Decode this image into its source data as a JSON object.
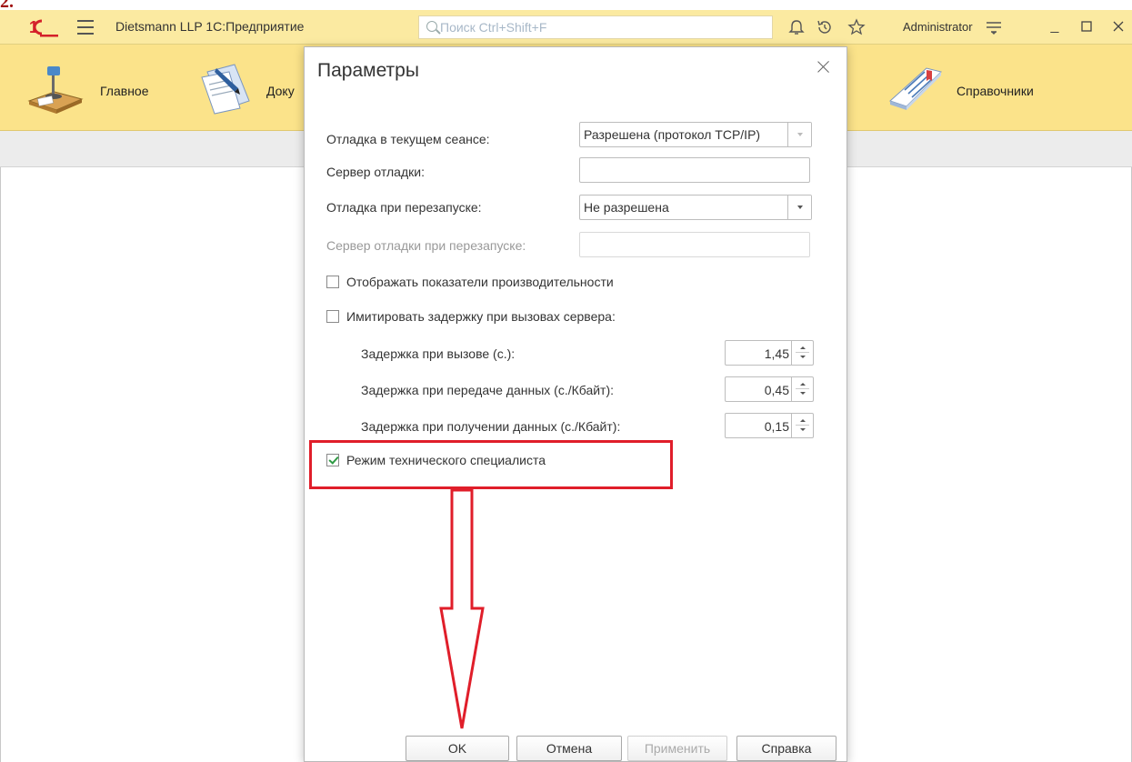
{
  "step_label": "2.",
  "titlebar": {
    "app_title": "Dietsmann LLP  1С:Предприятие",
    "search_placeholder": "Поиск Ctrl+Shift+F",
    "user": "Administrator"
  },
  "sections": [
    {
      "label": "Главное",
      "icon": "desk-lamp-icon"
    },
    {
      "label": "Доку",
      "icon": "documents-icon"
    },
    {
      "label": "Справочники",
      "icon": "catalog-books-icon"
    }
  ],
  "dialog": {
    "title": "Параметры",
    "fields": {
      "debug_session_label": "Отладка в текущем сеансе:",
      "debug_session_value": "Разрешена (протокол TCP/IP)",
      "debug_server_label": "Сервер отладки:",
      "debug_server_value": "",
      "debug_restart_label": "Отладка при перезапуске:",
      "debug_restart_value": "Не разрешена",
      "debug_restart_server_label": "Сервер отладки при перезапуске:",
      "debug_restart_server_value": ""
    },
    "checkboxes": {
      "perf_label": "Отображать показатели производительности",
      "perf_checked": false,
      "delay_label": "Имитировать задержку при вызовах сервера:",
      "delay_checked": false,
      "tech_label": "Режим технического специалиста",
      "tech_checked": true
    },
    "delays": {
      "call_label": "Задержка при вызове (с.):",
      "call_value": "1,45",
      "send_label": "Задержка при передаче данных (с./Кбайт):",
      "send_value": "0,45",
      "recv_label": "Задержка при получении данных (с./Кбайт):",
      "recv_value": "0,15"
    },
    "buttons": {
      "ok": "OK",
      "cancel": "Отмена",
      "apply": "Применить",
      "help": "Справка"
    }
  },
  "colors": {
    "titlebar_bg": "#fbeaa1",
    "sections_bg": "#fbe38a",
    "annotation_red": "#e01e2a",
    "checkmark_green": "#2e9a43"
  }
}
